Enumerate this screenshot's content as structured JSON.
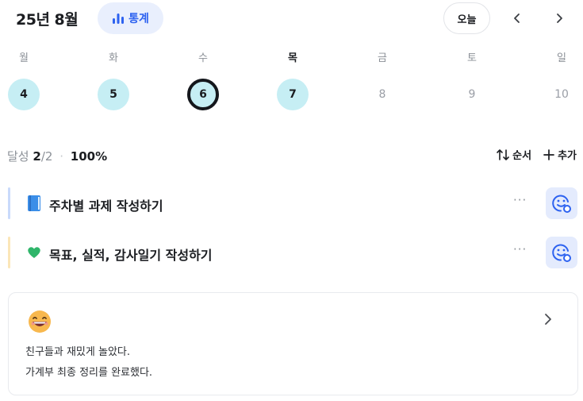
{
  "header": {
    "month_title": "25년 8월",
    "stats_label": "통계",
    "today_label": "오늘"
  },
  "week": {
    "labels": [
      "월",
      "화",
      "수",
      "목",
      "금",
      "토",
      "일"
    ],
    "days": [
      "4",
      "5",
      "6",
      "7",
      "8",
      "9",
      "10"
    ],
    "completed_days": [
      "4",
      "5",
      "6",
      "7"
    ],
    "selected_day": "6"
  },
  "summary": {
    "label": "달성",
    "done": "2",
    "total": "/2",
    "separator": "·",
    "percent": "100%",
    "sort_label": "순서",
    "add_label": "추가"
  },
  "tasks": [
    {
      "emoji": "blue-book-icon",
      "title": "주차별 과제 작성하기",
      "more": "···",
      "bar_color": "#c9dafb"
    },
    {
      "emoji": "green-heart-icon",
      "title": "목표, 실적, 감사일기 작성하기",
      "more": "···",
      "bar_color": "#fbe6b8"
    }
  ],
  "diary": {
    "emoji": "grinning-face-icon",
    "lines": [
      "친구들과 재밌게 놀았다.",
      "가계부 최종 정리를 완료했다."
    ]
  },
  "colors": {
    "accent": "#2d62f0",
    "accent_bg": "#e9effd",
    "completed_day": "#c6eef4",
    "selected_ring": "#14171c"
  }
}
